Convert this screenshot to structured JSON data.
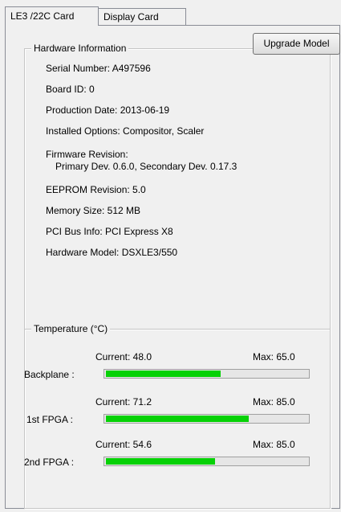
{
  "tabs": [
    {
      "label": "LE3 /22C Card",
      "active": true
    },
    {
      "label": "Display Card",
      "active": false
    }
  ],
  "hardware": {
    "legend": "Hardware Information",
    "upgrade_button": "Upgrade Model",
    "serial_number": "Serial Number: A497596",
    "board_id": "Board ID: 0",
    "production_date": "Production Date: 2013-06-19",
    "installed_options": "Installed Options: Compositor, Scaler",
    "firmware_title": "Firmware Revision:",
    "firmware_detail": "Primary Dev. 0.6.0, Secondary Dev. 0.17.3",
    "eeprom": "EEPROM Revision: 5.0",
    "memory": "Memory Size: 512 MB",
    "pci": "PCI Bus Info: PCI Express X8",
    "model": "Hardware Model: DSXLE3/550"
  },
  "temperature": {
    "legend": "Temperature (°C)",
    "sensors": [
      {
        "label": "Backplane :",
        "current": "Current: 48.0",
        "max": "Max: 65.0",
        "level": 0.57
      },
      {
        "label": "1st FPGA :",
        "current": "Current: 71.2",
        "max": "Max: 85.0",
        "level": 0.71
      },
      {
        "label": "2nd FPGA :",
        "current": "Current: 54.6",
        "max": "Max: 85.0",
        "level": 0.54
      }
    ],
    "bar_color": "#06d106"
  }
}
